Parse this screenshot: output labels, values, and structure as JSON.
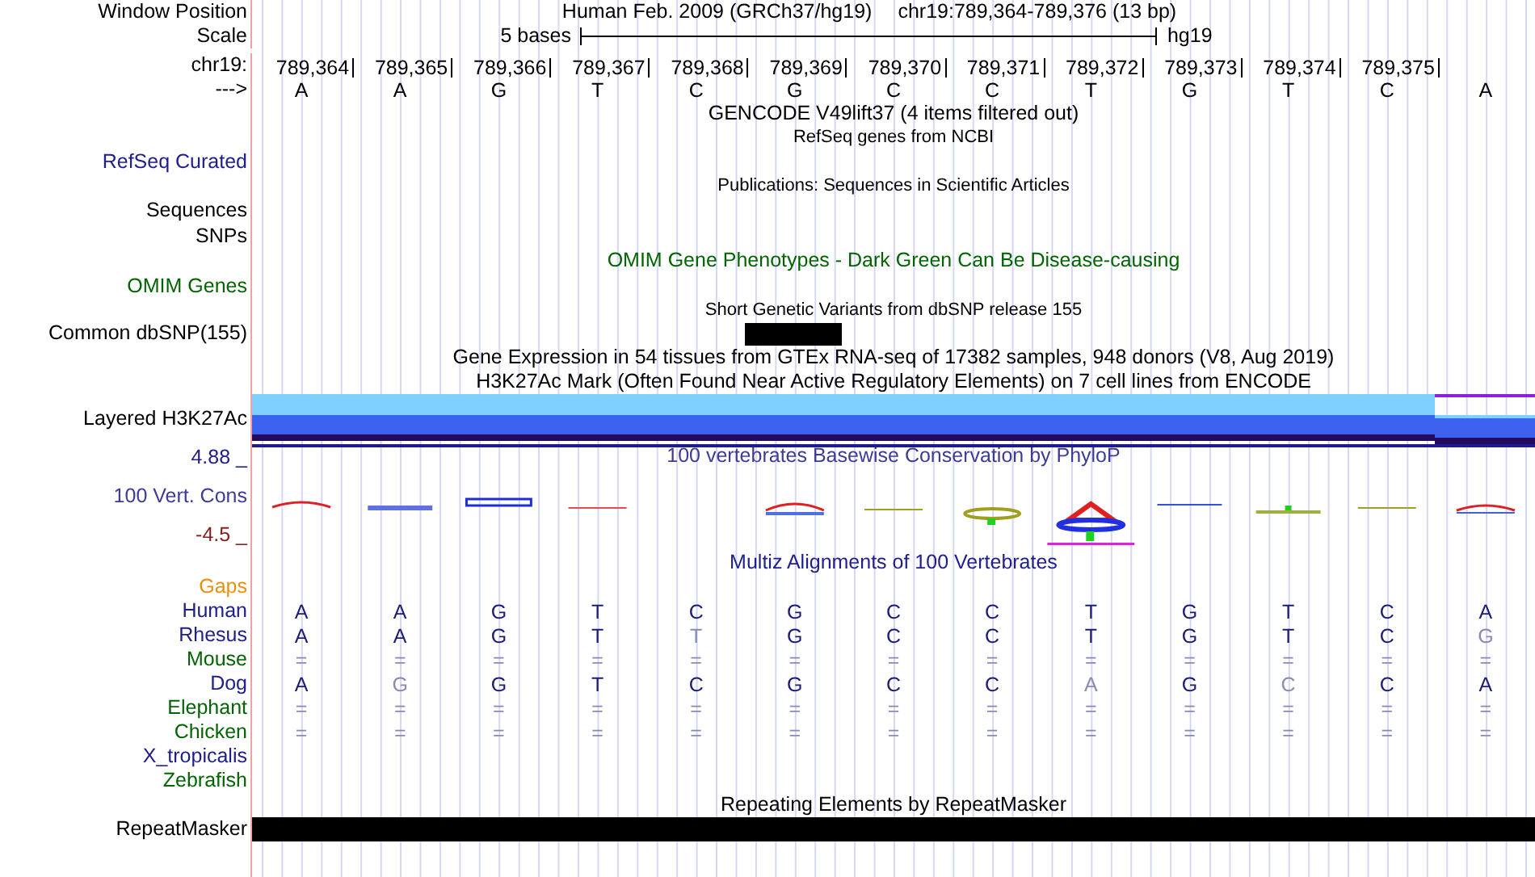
{
  "header": {
    "window_label": "Window Position",
    "assembly": "Human Feb. 2009 (GRCh37/hg19)",
    "position": "chr19:789,364-789,376 (13 bp)",
    "scale_label": "Scale",
    "scale_text": "5 bases",
    "scale_assembly": "hg19",
    "chrom_label": "chr19:",
    "positions": [
      "789,364",
      "789,365",
      "789,366",
      "789,367",
      "789,368",
      "789,369",
      "789,370",
      "789,371",
      "789,372",
      "789,373",
      "789,374",
      "789,375"
    ],
    "strand_label": "--->",
    "bases": [
      "A",
      "A",
      "G",
      "T",
      "C",
      "G",
      "C",
      "C",
      "T",
      "G",
      "T",
      "C",
      "A"
    ]
  },
  "rows": [
    {
      "kind": "title",
      "text": "GENCODE V49lift37 (4 items filtered out)",
      "color": "#000000"
    },
    {
      "kind": "subtitle",
      "text": "RefSeq genes from NCBI"
    },
    {
      "kind": "label",
      "label": "RefSeq Curated",
      "color": "#20208c"
    },
    {
      "kind": "subtitle",
      "text": "Publications: Sequences in Scientific Articles"
    },
    {
      "kind": "label",
      "label": "Sequences",
      "color": "#000000"
    },
    {
      "kind": "label",
      "label": "SNPs",
      "color": "#000000"
    },
    {
      "kind": "title",
      "text": "OMIM Gene Phenotypes - Dark Green Can Be Disease-causing",
      "color": "#006400"
    },
    {
      "kind": "label",
      "label": "OMIM Genes",
      "color": "#006400"
    },
    {
      "kind": "subtitle",
      "text": "Short Genetic Variants from dbSNP release 155"
    },
    {
      "kind": "variant",
      "label": "Common dbSNP(155)",
      "color": "#000000"
    },
    {
      "kind": "title",
      "text": "Gene Expression in 54 tissues from GTEx RNA-seq of 17382 samples, 948 donors (V8, Aug 2019)",
      "color": "#000000"
    },
    {
      "kind": "title",
      "text": "H3K27Ac Mark (Often Found Near Active Regulatory Elements) on 7 cell lines from ENCODE",
      "color": "#000000"
    },
    {
      "kind": "layered",
      "label": "Layered H3K27Ac",
      "color": "#000000"
    },
    {
      "kind": "conservation",
      "title": "100 vertebrates Basewise Conservation by PhyloP",
      "label": "100 Vert. Cons",
      "max": "4.88 _",
      "min": "-4.5 _",
      "color": "#3c3c96"
    },
    {
      "kind": "title",
      "text": "Multiz Alignments of 100 Vertebrates",
      "color": "#20208c"
    },
    {
      "kind": "species",
      "label": "Gaps",
      "color": "#e8900c",
      "bases": []
    },
    {
      "kind": "species",
      "label": "Human",
      "color": "#20208c",
      "bases": [
        {
          "base": "A",
          "faded": false
        },
        {
          "base": "A",
          "faded": false
        },
        {
          "base": "G",
          "faded": false
        },
        {
          "base": "T",
          "faded": false
        },
        {
          "base": "C",
          "faded": false
        },
        {
          "base": "G",
          "faded": false
        },
        {
          "base": "C",
          "faded": false
        },
        {
          "base": "C",
          "faded": false
        },
        {
          "base": "T",
          "faded": false
        },
        {
          "base": "G",
          "faded": false
        },
        {
          "base": "T",
          "faded": false
        },
        {
          "base": "C",
          "faded": false
        },
        {
          "base": "A",
          "faded": false
        }
      ]
    },
    {
      "kind": "species",
      "label": "Rhesus",
      "color": "#20208c",
      "bases": [
        {
          "base": "A",
          "faded": false
        },
        {
          "base": "A",
          "faded": false
        },
        {
          "base": "G",
          "faded": false
        },
        {
          "base": "T",
          "faded": false
        },
        {
          "base": "T",
          "faded": true
        },
        {
          "base": "G",
          "faded": false
        },
        {
          "base": "C",
          "faded": false
        },
        {
          "base": "C",
          "faded": false
        },
        {
          "base": "T",
          "faded": false
        },
        {
          "base": "G",
          "faded": false
        },
        {
          "base": "T",
          "faded": false
        },
        {
          "base": "C",
          "faded": false
        },
        {
          "base": "G",
          "faded": true
        }
      ]
    },
    {
      "kind": "species",
      "label": "Mouse",
      "color": "#006400",
      "bases": [
        {
          "base": "=",
          "faded": true
        },
        {
          "base": "=",
          "faded": true
        },
        {
          "base": "=",
          "faded": true
        },
        {
          "base": "=",
          "faded": true
        },
        {
          "base": "=",
          "faded": true
        },
        {
          "base": "=",
          "faded": true
        },
        {
          "base": "=",
          "faded": true
        },
        {
          "base": "=",
          "faded": true
        },
        {
          "base": "=",
          "faded": true
        },
        {
          "base": "=",
          "faded": true
        },
        {
          "base": "=",
          "faded": true
        },
        {
          "base": "=",
          "faded": true
        },
        {
          "base": "=",
          "faded": true
        }
      ]
    },
    {
      "kind": "species",
      "label": "Dog",
      "color": "#20208c",
      "bases": [
        {
          "base": "A",
          "faded": false
        },
        {
          "base": "G",
          "faded": true
        },
        {
          "base": "G",
          "faded": false
        },
        {
          "base": "T",
          "faded": false
        },
        {
          "base": "C",
          "faded": false
        },
        {
          "base": "G",
          "faded": false
        },
        {
          "base": "C",
          "faded": false
        },
        {
          "base": "C",
          "faded": false
        },
        {
          "base": "A",
          "faded": true
        },
        {
          "base": "G",
          "faded": false
        },
        {
          "base": "C",
          "faded": true
        },
        {
          "base": "C",
          "faded": false
        },
        {
          "base": "A",
          "faded": false
        }
      ]
    },
    {
      "kind": "species",
      "label": "Elephant",
      "color": "#006400",
      "bases": [
        {
          "base": "=",
          "faded": true
        },
        {
          "base": "=",
          "faded": true
        },
        {
          "base": "=",
          "faded": true
        },
        {
          "base": "=",
          "faded": true
        },
        {
          "base": "=",
          "faded": true
        },
        {
          "base": "=",
          "faded": true
        },
        {
          "base": "=",
          "faded": true
        },
        {
          "base": "=",
          "faded": true
        },
        {
          "base": "=",
          "faded": true
        },
        {
          "base": "=",
          "faded": true
        },
        {
          "base": "=",
          "faded": true
        },
        {
          "base": "=",
          "faded": true
        },
        {
          "base": "=",
          "faded": true
        }
      ]
    },
    {
      "kind": "species",
      "label": "Chicken",
      "color": "#006400",
      "bases": [
        {
          "base": "=",
          "faded": true
        },
        {
          "base": "=",
          "faded": true
        },
        {
          "base": "=",
          "faded": true
        },
        {
          "base": "=",
          "faded": true
        },
        {
          "base": "=",
          "faded": true
        },
        {
          "base": "=",
          "faded": true
        },
        {
          "base": "=",
          "faded": true
        },
        {
          "base": "=",
          "faded": true
        },
        {
          "base": "=",
          "faded": true
        },
        {
          "base": "=",
          "faded": true
        },
        {
          "base": "=",
          "faded": true
        },
        {
          "base": "=",
          "faded": true
        },
        {
          "base": "=",
          "faded": true
        }
      ]
    },
    {
      "kind": "species",
      "label": "X_tropicalis",
      "color": "#20208c",
      "bases": []
    },
    {
      "kind": "species",
      "label": "Zebrafish",
      "color": "#006400",
      "bases": []
    },
    {
      "kind": "title",
      "text": "Repeating Elements by RepeatMasker",
      "color": "#000000"
    },
    {
      "kind": "repeat",
      "label": "RepeatMasker",
      "color": "#000000"
    }
  ]
}
